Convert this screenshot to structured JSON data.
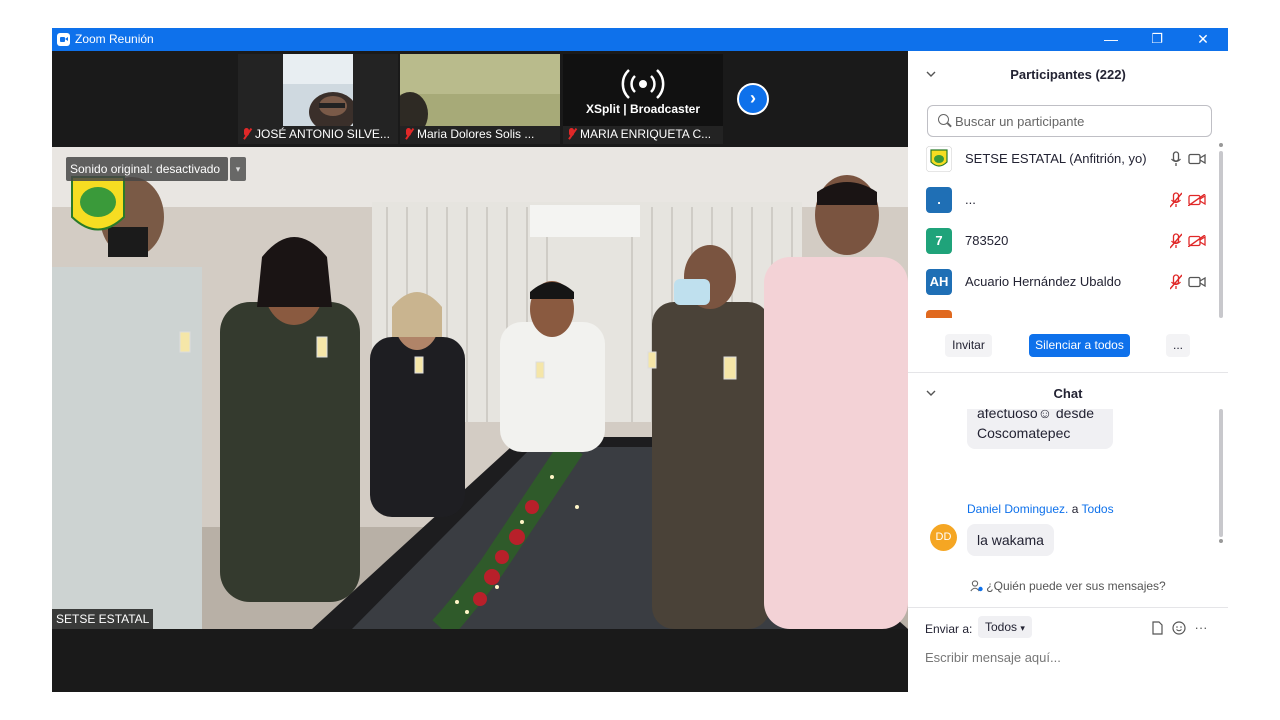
{
  "window": {
    "title": "Zoom Reunión",
    "minimize": "—",
    "restore": "❐",
    "close": "✕"
  },
  "thumbnails": [
    {
      "name": "JOSÉ ANTONIO SILVE..."
    },
    {
      "name": "Maria Dolores Solis ..."
    },
    {
      "name": "MARIA ENRIQUETA C...",
      "logo_text": "XSplit | Broadcaster"
    }
  ],
  "next_page": "›",
  "main_video": {
    "sound_pill": "Sonido original: desactivado",
    "sound_caret": "▾",
    "speaker": "SETSE ESTATAL"
  },
  "participants": {
    "header": "Participantes (222)",
    "search_placeholder": "Buscar un participante",
    "list": [
      {
        "avatar": "",
        "avatar_color": "#f6c32a",
        "name": "SETSE ESTATAL (Anfitrión, yo)",
        "muted": false
      },
      {
        "avatar": ".",
        "avatar_color": "#1f6fb5",
        "name": "...",
        "muted": true
      },
      {
        "avatar": "7",
        "avatar_color": "#1fa37a",
        "name": "783520",
        "muted": true
      },
      {
        "avatar": "AH",
        "avatar_color": "#1f6fb5",
        "name": "Acuario Hernández Ubaldo",
        "muted": true
      }
    ],
    "invite": "Invitar",
    "mute_all": "Silenciar a todos",
    "more": "..."
  },
  "chat": {
    "header": "Chat",
    "prev_message": "afectuoso☺ desde Coscomatepec",
    "sender": "Daniel Dominguez.",
    "to_word": "a",
    "recipient": "Todos",
    "avatar": "DD",
    "message": "la wakama",
    "who_sees": "¿Quién puede ver sus mensajes?",
    "send_to_label": "Enviar a:",
    "send_to_value": "Todos",
    "input_placeholder": "Escribir mensaje aquí...",
    "more_tools": "···"
  }
}
